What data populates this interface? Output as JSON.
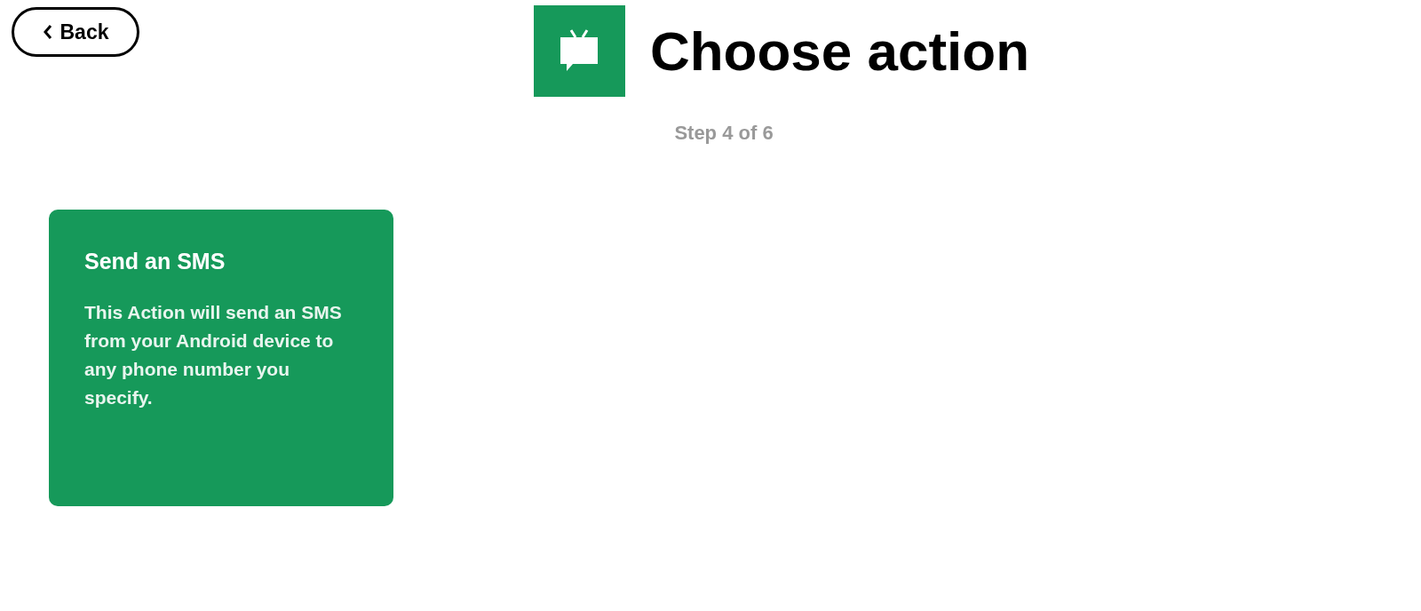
{
  "back_button": {
    "label": "Back"
  },
  "header": {
    "title": "Choose action",
    "step": "Step 4 of 6"
  },
  "actions": [
    {
      "title": "Send an SMS",
      "description": "This Action will send an SMS from your Android device to any phone number you specify."
    }
  ]
}
